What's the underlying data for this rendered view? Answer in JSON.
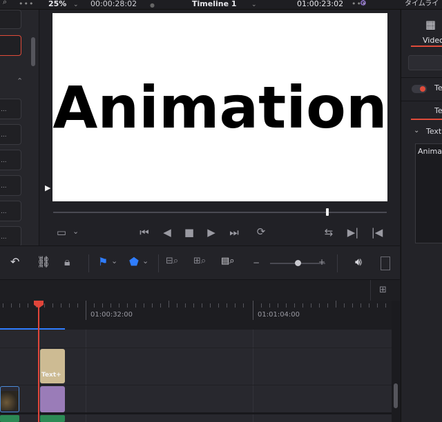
{
  "topbar": {
    "zoom": "25%",
    "source_timecode": "00:00:28:02",
    "timeline_name": "Timeline 1",
    "record_timecode": "01:00:23:02",
    "right_label": "タイムライ"
  },
  "viewer": {
    "title_text": "Animation"
  },
  "media_panel": {
    "list_items": [
      "...",
      "...",
      "...",
      "...",
      "...",
      "..."
    ]
  },
  "inspector": {
    "tab_video": "Video",
    "toggle_label": "Te",
    "sub_tab": "Te",
    "section_title": "Text",
    "text_field_value": "Anima"
  },
  "timeline": {
    "ruler_labels": [
      "01:00:32:00",
      "01:01:04:00"
    ],
    "clip_label": "Text+"
  },
  "colors": {
    "playhead": "#e0453a",
    "text_clip": "#cdbb93",
    "purple_clip": "#9a7cb8",
    "green_clip": "#2c8a55",
    "marker_blue": "#2f7dff",
    "accent_red": "#e04b3a"
  }
}
